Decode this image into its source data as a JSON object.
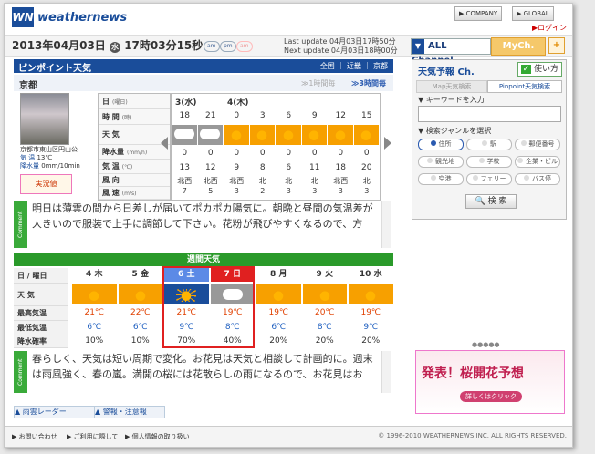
{
  "header": {
    "logo": "WN",
    "brand": "weathernews",
    "company_label": "COMPANY",
    "global_label": "GLOBAL",
    "login_label": "ログイン"
  },
  "datebar": {
    "date": "2013年04月03日",
    "weekday": "水",
    "time": "17時03分15秒",
    "badge1": "am",
    "badge2": "pm",
    "badge3": "am",
    "last_update_label": "Last update",
    "last_update": "04月03日17時50分",
    "next_update_label": "Next update",
    "next_update": "04月03日18時00分",
    "all_channel": "ALL Channel",
    "mych": "MyCh.",
    "plus": "+"
  },
  "pinpoint": {
    "title": "ピンポイント天気",
    "breadcrumb": [
      "全国",
      "近畿",
      "京都"
    ],
    "location": "京都",
    "one_hour": "1時間毎",
    "three_hour": "3時間毎",
    "place_name": "京都市東山区円山公",
    "temp_label": "気 温",
    "temp_value": "13℃",
    "precip_label": "降水量",
    "precip_value": "0mm/10min",
    "live_label": "実況値",
    "row_labels": [
      "日",
      "時 間",
      "天 気",
      "降水量",
      "気 温",
      "風 向",
      "風 速"
    ],
    "row_units": [
      "(曜日)",
      "(時)",
      "",
      "(mm/h)",
      "(℃)",
      "",
      "(m/s)"
    ],
    "days": [
      "3(水)",
      "4(木)"
    ],
    "hours": [
      "18",
      "21",
      "0",
      "3",
      "6",
      "9",
      "12",
      "15"
    ],
    "weather": [
      "cloud",
      "cloud",
      "sun",
      "sun",
      "sun",
      "sun",
      "sun",
      "sun"
    ],
    "precip": [
      "0",
      "0",
      "0",
      "0",
      "0",
      "0",
      "0",
      "0"
    ],
    "temp": [
      "13",
      "12",
      "9",
      "8",
      "6",
      "11",
      "18",
      "20"
    ],
    "wind_dir": [
      "北西",
      "北西",
      "北西",
      "北",
      "北",
      "北",
      "北西",
      "北"
    ],
    "wind_speed": [
      "7",
      "5",
      "3",
      "2",
      "3",
      "3",
      "3",
      "3"
    ],
    "comment_label": "Comment",
    "comment": "明日は薄雲の間から日差しが届いてポカポカ陽気に。朝晩と昼間の気温差が大きいので服装で上手に調節して下さい。花粉が飛びやすくなるので、方"
  },
  "weekly": {
    "title": "週間天気",
    "row_labels": [
      "日 / 曜日",
      "天 気",
      "最高気温",
      "最低気温",
      "降水確率"
    ],
    "days": [
      "4 木",
      "5 金",
      "6 土",
      "7 日",
      "8 月",
      "9 火",
      "10 水"
    ],
    "weather": [
      "sun-cloud",
      "sun-cloud",
      "rain",
      "cloud",
      "sun-cloud",
      "cloud-sun",
      "cloud-sun"
    ],
    "high": [
      "21℃",
      "22℃",
      "21℃",
      "19℃",
      "19℃",
      "20℃",
      "19℃"
    ],
    "low": [
      "6℃",
      "6℃",
      "9℃",
      "8℃",
      "6℃",
      "8℃",
      "9℃"
    ],
    "pop": [
      "10%",
      "10%",
      "70%",
      "40%",
      "20%",
      "20%",
      "20%"
    ],
    "comment": "春らしく、天気は短い周期で変化。お花見は天気と相談して計画的に。週末は雨風強く、春の嵐。満開の桜には花散らしの雨になるので、お花見はお"
  },
  "bottom_links": [
    "雨雲レーダー",
    "警報・注意報"
  ],
  "sidebar": {
    "title": "天気予報 Ch.",
    "howto": "使い方",
    "tab_map": "Map天気検索",
    "tab_pinpoint": "Pinpoint天気検索",
    "keyword_label": "キーワードを入力",
    "genre_label": "検索ジャンルを選択",
    "genres": [
      "住所",
      "駅",
      "郵便番号",
      "観光地",
      "学校",
      "企業・ビル",
      "空港",
      "フェリー",
      "バス停"
    ],
    "search_button": "検 索"
  },
  "ad": {
    "headline": "発表！桜開花予想",
    "cta": "詳しくはクリック"
  },
  "footer": {
    "links": [
      "お問い合わせ",
      "ご利用に際して",
      "個人情報の取り扱い"
    ],
    "copyright": "© 1996-2010 WEATHERNEWS INC. ALL RIGHTS RESERVED."
  },
  "colors": {
    "brand": "#1a4d9a",
    "green": "#2a9a2a",
    "orange_cell": "#f7a000",
    "highlight": "#e02020"
  }
}
